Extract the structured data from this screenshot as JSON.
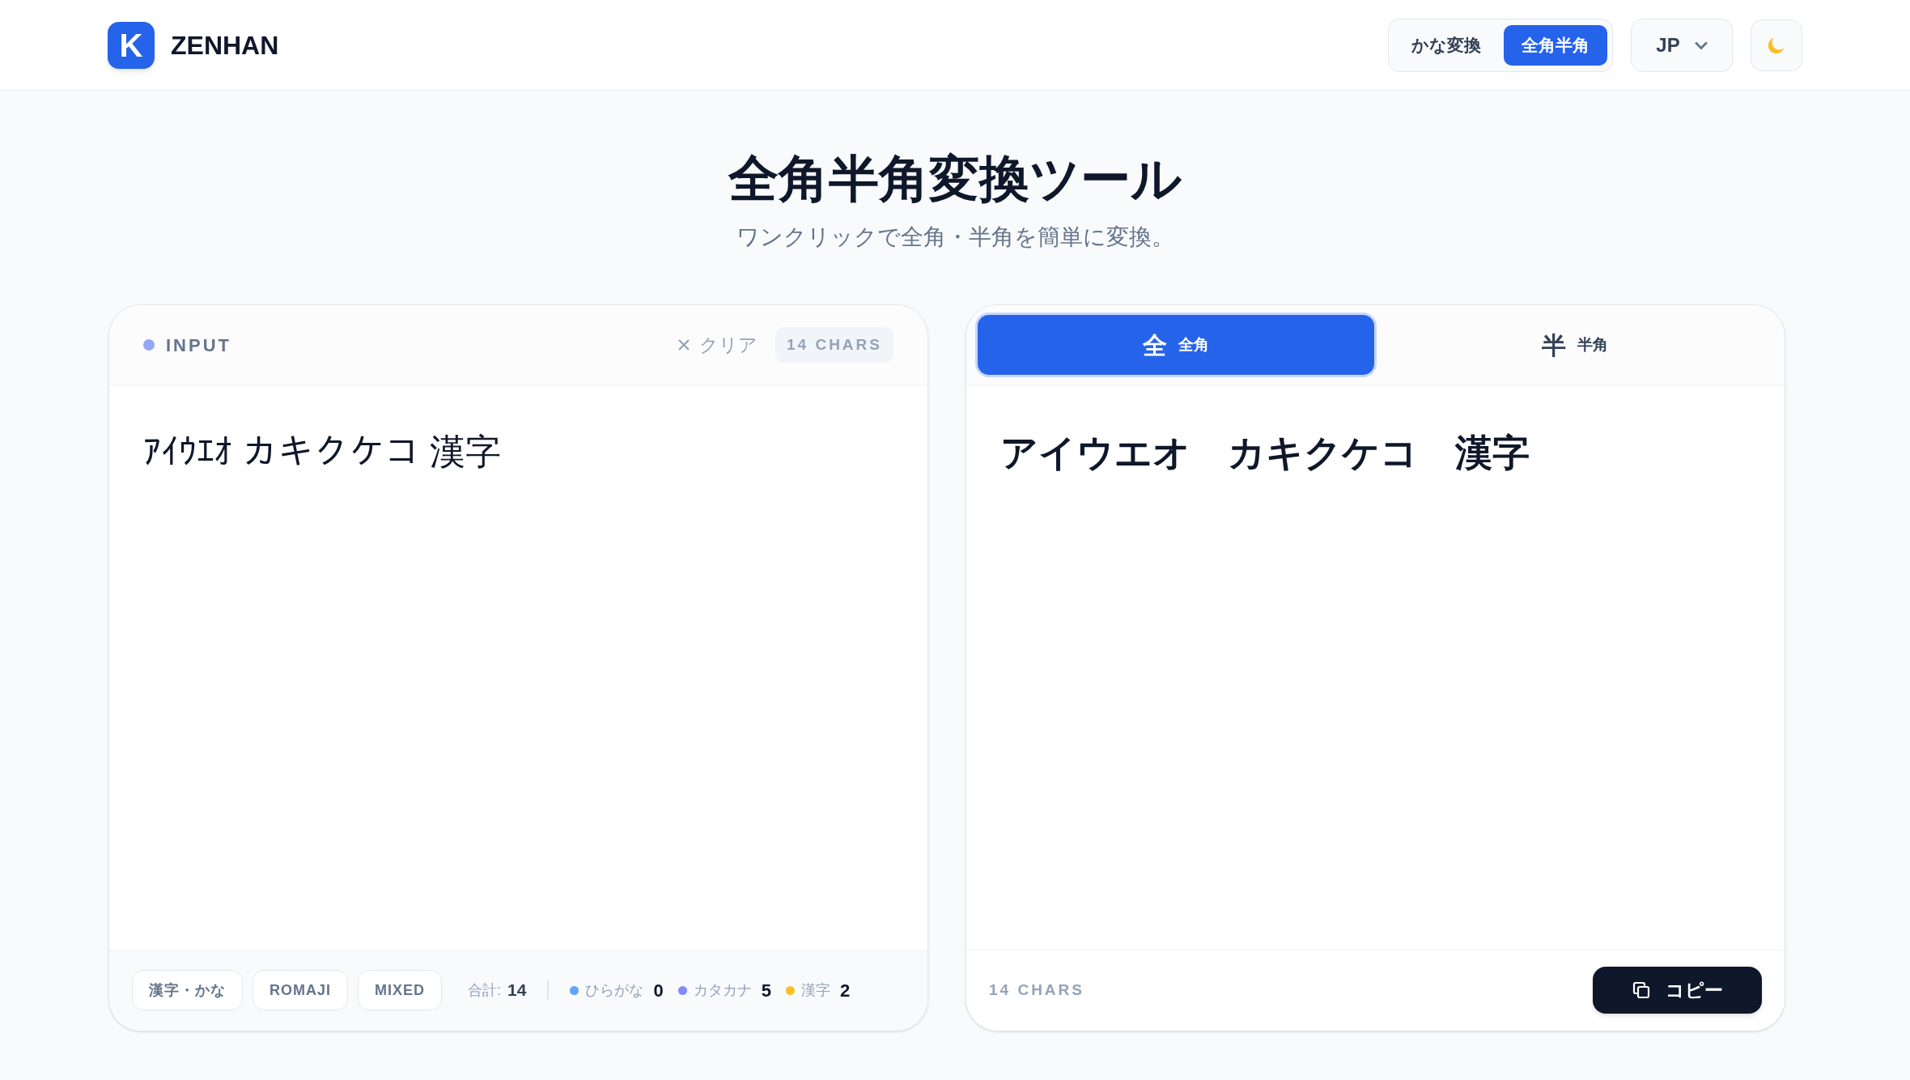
{
  "header": {
    "brand": "ZENHAN",
    "logo_letter": "K",
    "mode_toggle": [
      {
        "label": "かな変換",
        "selected": false
      },
      {
        "label": "全角半角",
        "selected": true
      }
    ],
    "language": "JP"
  },
  "hero": {
    "title": "全角半角変換ツール",
    "subtitle": "ワンクリックで全角・半角を簡単に変換。"
  },
  "input_panel": {
    "label": "INPUT",
    "clear": "クリア",
    "count": "14 CHARS",
    "text": "ｱｲｳｴｵ カキクケコ 漢字",
    "modes": [
      "漢字・かな",
      "ROMAJI",
      "MIXED"
    ],
    "total_label": "合計:",
    "total": "14",
    "stats": [
      {
        "label": "ひらがな",
        "value": "0",
        "color": "#60a5fa"
      },
      {
        "label": "カタカナ",
        "value": "5",
        "color": "#818cf8"
      },
      {
        "label": "漢字",
        "value": "2",
        "color": "#fbbf24"
      }
    ]
  },
  "output_panel": {
    "tabs": [
      {
        "glyph": "全",
        "label": "全角",
        "selected": true
      },
      {
        "glyph": "半",
        "label": "半角",
        "selected": false
      }
    ],
    "text": "アイウエオ　カキクケコ　漢字",
    "count": "14 CHARS",
    "copy": "コピー"
  }
}
